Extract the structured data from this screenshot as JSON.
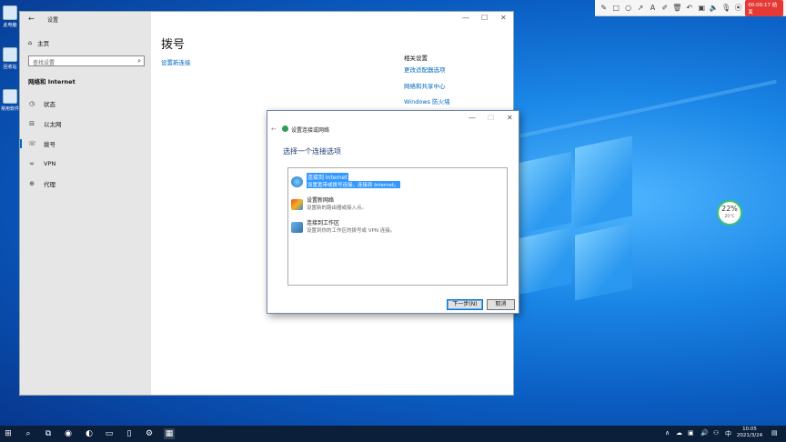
{
  "desktop": {
    "icons": [
      "此电脑",
      "回收站",
      "常用软件"
    ]
  },
  "recorder": {
    "time": "00:00:17 结束"
  },
  "settings": {
    "title": "设置",
    "home": "主页",
    "search_placeholder": "查找设置",
    "section": "网络和 Internet",
    "nav": [
      "状态",
      "以太网",
      "拨号",
      "VPN",
      "代理"
    ],
    "page_title": "拨号",
    "setup_link": "设置新连接",
    "related_title": "相关设置",
    "related_links": [
      "更改适配器选项",
      "网络和共享中心",
      "Windows 防火墙"
    ]
  },
  "dialog": {
    "title": "设置连接或网络",
    "heading": "选择一个连接选项",
    "options": [
      {
        "title": "连接到 Internet",
        "desc": "设置宽带或拨号连接，连接到 Internet。"
      },
      {
        "title": "设置新网络",
        "desc": "设置新的路由器或接入点。"
      },
      {
        "title": "连接到工作区",
        "desc": "设置到你的工作区的拨号或 VPN 连接。"
      }
    ],
    "next": "下一步(N)",
    "cancel": "取消"
  },
  "widget": {
    "percent": "22%",
    "temp": "25°C"
  },
  "clock": {
    "time": "10:05",
    "date": "2021/3/24"
  },
  "colors": {
    "accent": "#0067c0",
    "selection": "#3399ff",
    "record": "#e53935"
  }
}
